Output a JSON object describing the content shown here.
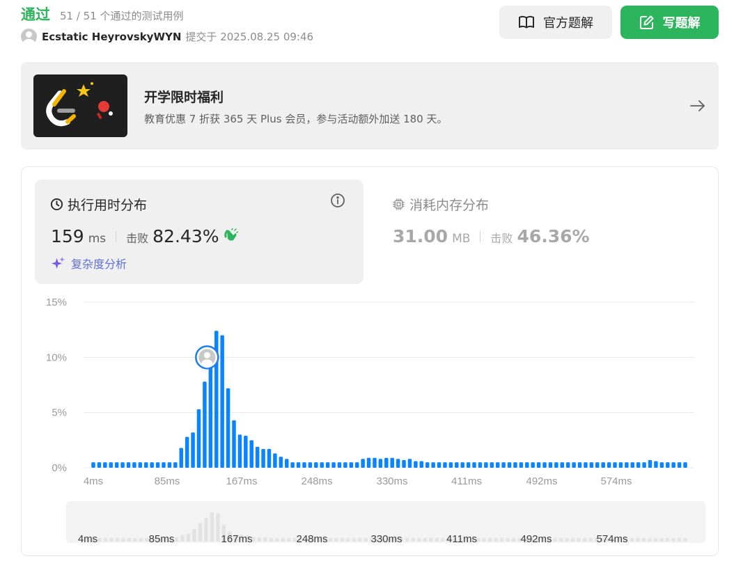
{
  "header": {
    "status": "通过",
    "testcases": "51 / 51 个通过的测试用例",
    "user": "Ecstatic HeyrovskyWYN",
    "submitted": "提交于 2025.08.25 09:46"
  },
  "buttons": {
    "solution": "官方题解",
    "write": "写题解"
  },
  "promo": {
    "title": "开学限时福利",
    "desc": "教育优惠 7 折获 365 天 Plus 会员，参与活动额外加送 180 天。"
  },
  "runtime": {
    "title": "执行用时分布",
    "value": "159",
    "unit": "ms",
    "beat_label": "击败",
    "beat": "82.43%",
    "analysis": "复杂度分析"
  },
  "memory": {
    "title": "消耗内存分布",
    "value": "31.00",
    "unit": "MB",
    "beat_label": "击败",
    "beat": "46.36%"
  },
  "colors": {
    "accent_green": "#2db55d",
    "bar_blue": "#0a84ff",
    "marker_blue": "#1a7cf2",
    "overview_grey": "#e3e3e3"
  },
  "chart_data": {
    "type": "bar",
    "ylabel_ticks": [
      "0%",
      "5%",
      "10%",
      "15%"
    ],
    "xtick_labels": [
      "4ms",
      "85ms",
      "167ms",
      "248ms",
      "330ms",
      "411ms",
      "492ms",
      "574ms"
    ],
    "ylim": [
      0,
      15
    ],
    "grid": true,
    "marker_index": 20,
    "values": [
      0.5,
      0.5,
      0.5,
      0.5,
      0.5,
      0.5,
      0.5,
      0.5,
      0.5,
      0.5,
      0.5,
      0.5,
      0.5,
      0.5,
      0.5,
      1.8,
      2.8,
      3.2,
      5.3,
      7.8,
      10.0,
      12.4,
      12.0,
      7.2,
      4.3,
      3.0,
      2.9,
      2.5,
      1.9,
      1.7,
      1.7,
      1.3,
      1.0,
      0.8,
      0.5,
      0.5,
      0.5,
      0.5,
      0.5,
      0.5,
      0.5,
      0.5,
      0.5,
      0.5,
      0.5,
      0.5,
      0.8,
      0.9,
      0.9,
      0.8,
      0.9,
      0.9,
      0.8,
      0.7,
      0.8,
      0.6,
      0.6,
      0.5,
      0.5,
      0.5,
      0.5,
      0.5,
      0.5,
      0.5,
      0.5,
      0.5,
      0.5,
      0.5,
      0.5,
      0.5,
      0.5,
      0.5,
      0.5,
      0.5,
      0.5,
      0.5,
      0.5,
      0.5,
      0.5,
      0.5,
      0.5,
      0.5,
      0.5,
      0.5,
      0.5,
      0.5,
      0.5,
      0.5,
      0.5,
      0.5,
      0.5,
      0.5,
      0.5,
      0.5,
      0.5,
      0.7,
      0.6,
      0.5,
      0.5,
      0.5,
      0.5,
      0.5
    ]
  }
}
